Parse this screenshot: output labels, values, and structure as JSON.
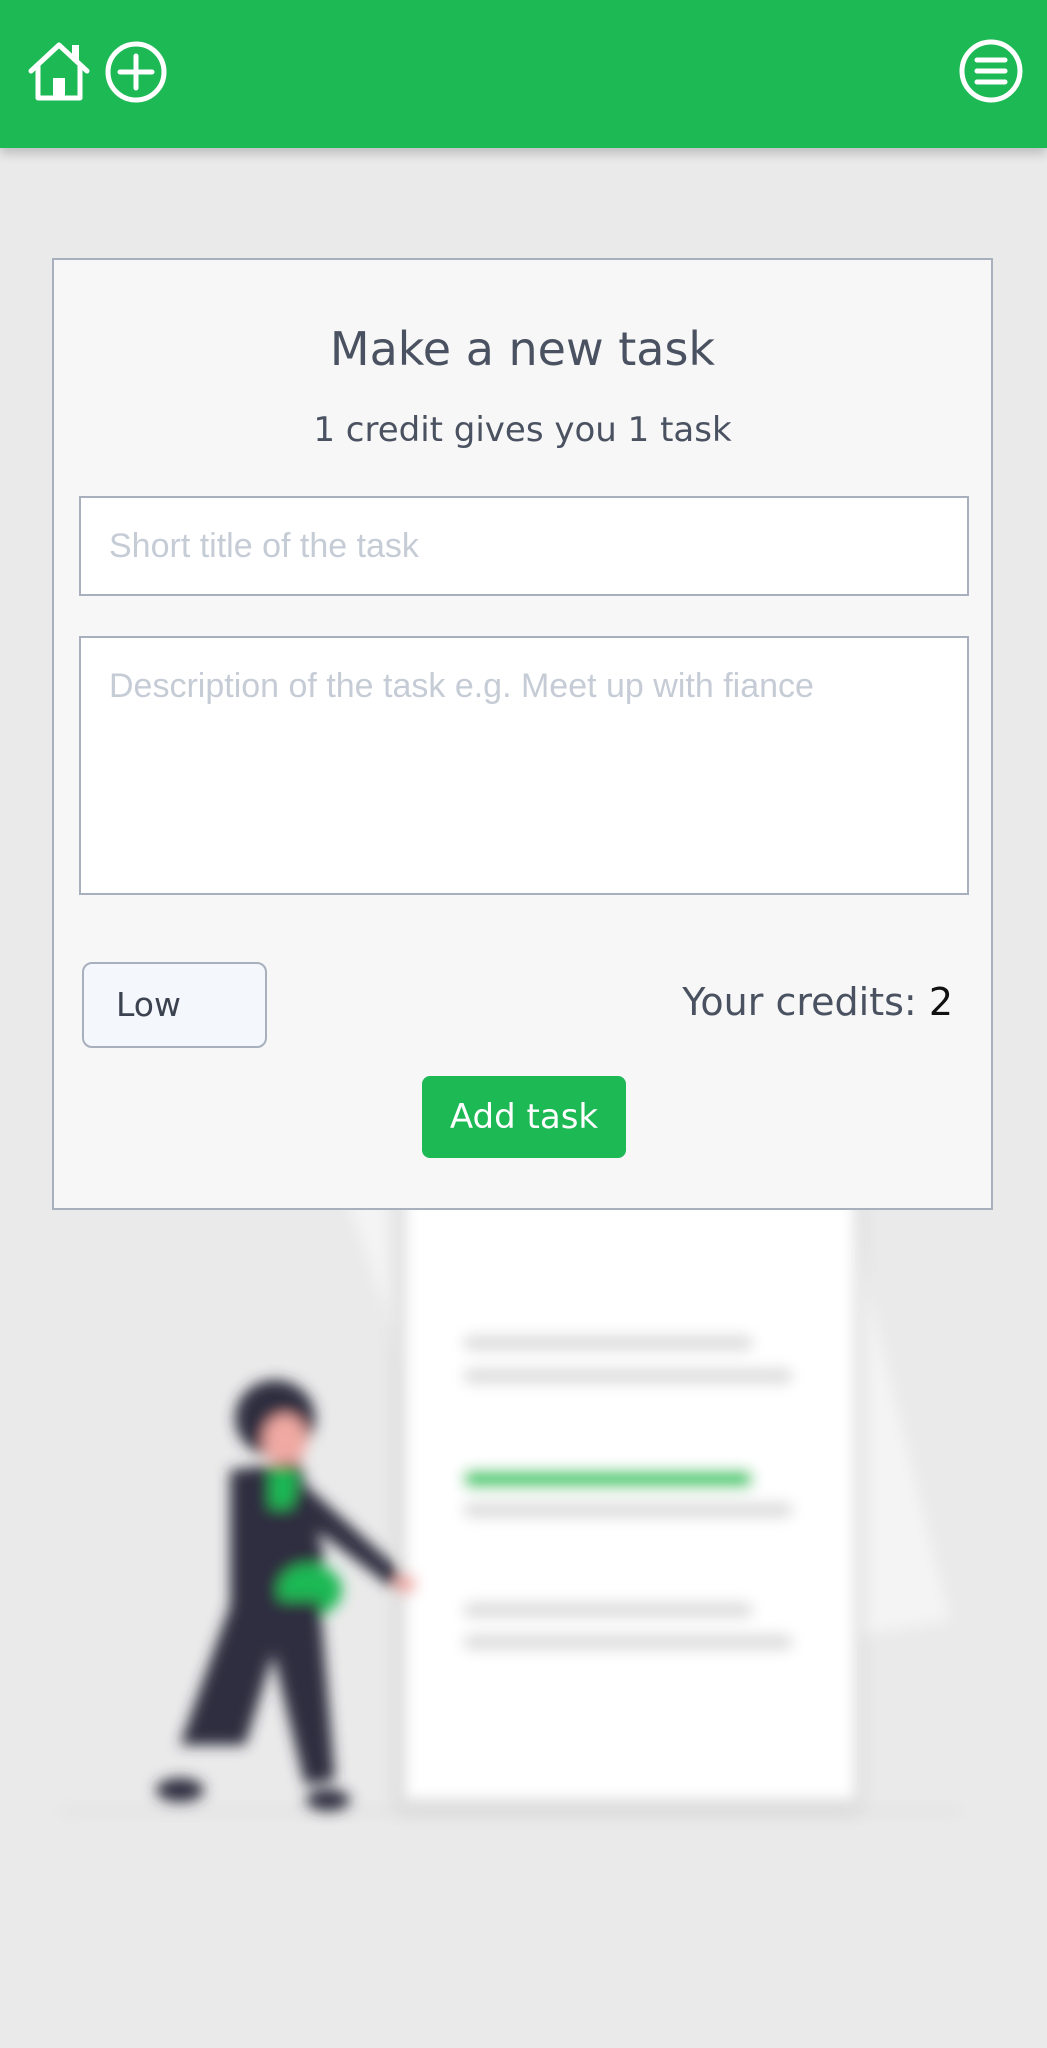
{
  "topbar": {
    "color": "#1db954",
    "icons": [
      "home-icon",
      "add-circle-icon",
      "menu-icon"
    ]
  },
  "form": {
    "title": "Make a new task",
    "subtitle": "1 credit gives you 1 task",
    "title_input": {
      "placeholder": "Short title of the task",
      "value": ""
    },
    "description_input": {
      "placeholder": "Description of the task e.g. Meet up with fiance",
      "value": ""
    },
    "priority": {
      "selected": "Low"
    },
    "credits_label": "Your credits:",
    "credits_value": "2",
    "submit_label": "Add task"
  }
}
